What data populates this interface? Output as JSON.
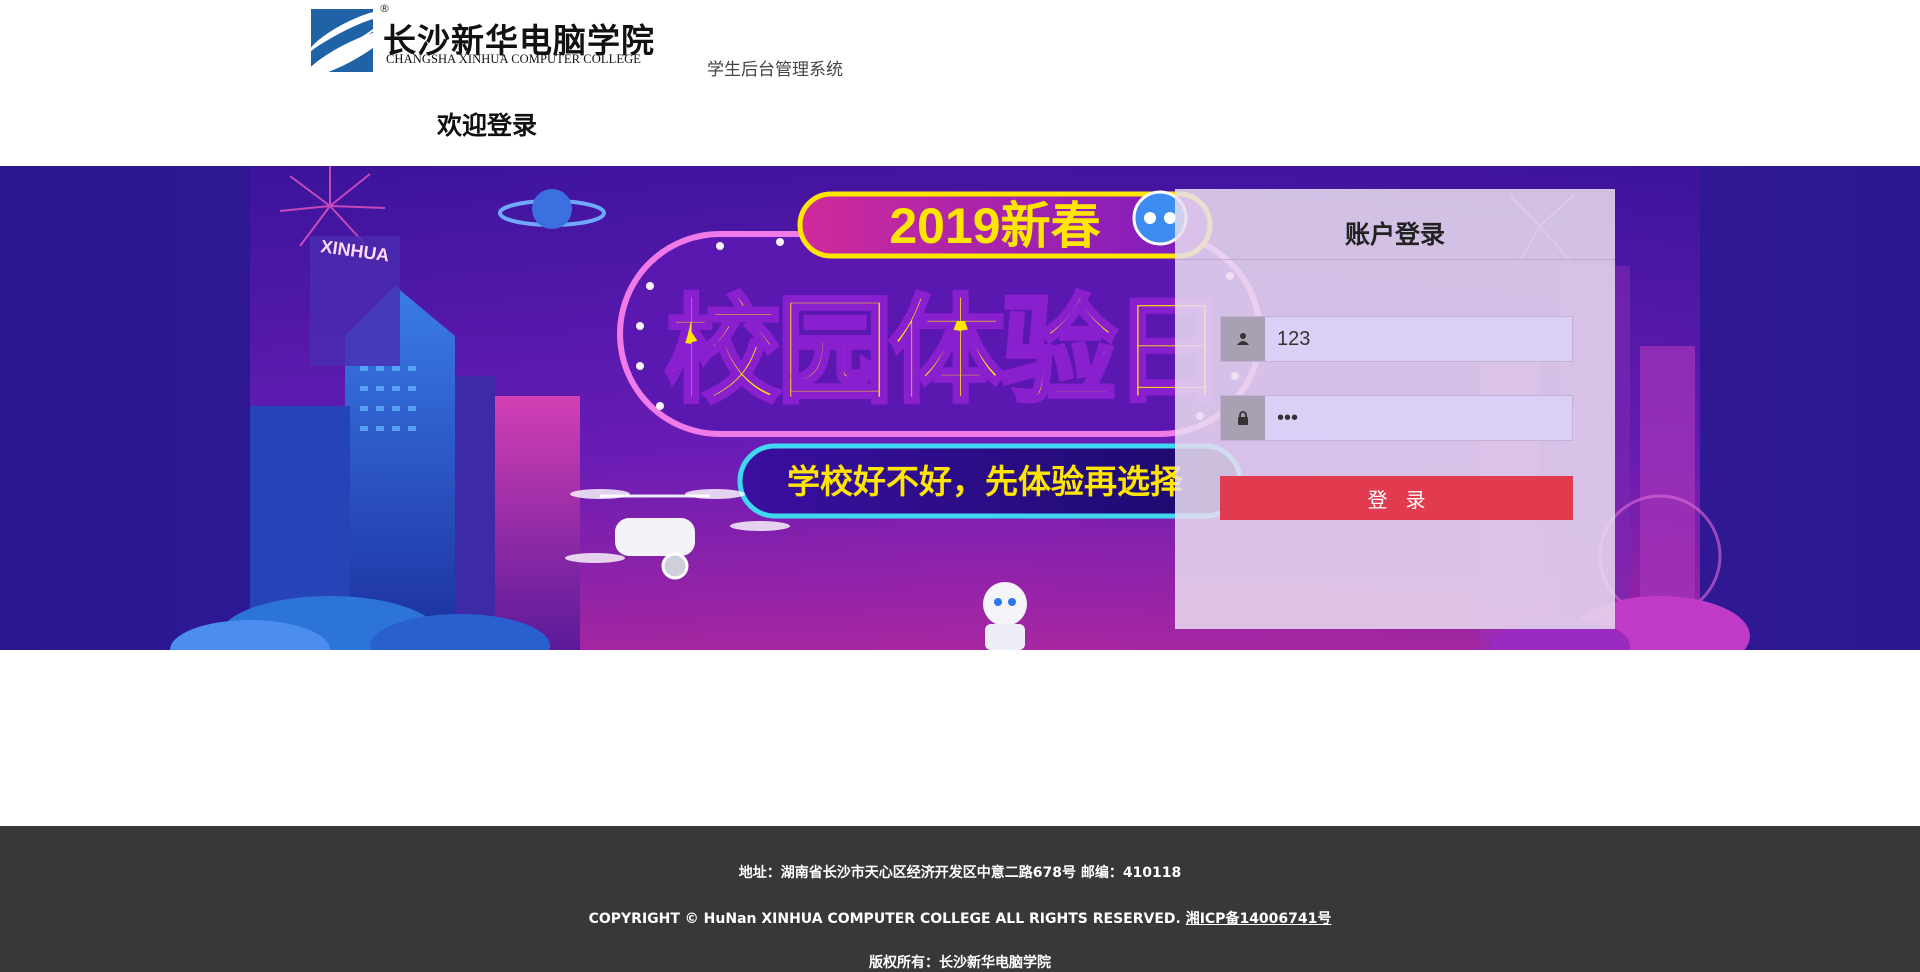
{
  "header": {
    "logo": {
      "registered_mark": "®",
      "name_cn": "长沙新华电脑学院",
      "name_en": "CHANGSHA XINHUA COMPUTER COLLEGE"
    },
    "system_name": "学生后台管理系统",
    "welcome": "欢迎登录"
  },
  "banner": {
    "headline_year": "2019新春",
    "headline_main": "校园体验日",
    "slogan": "学校好不好，先体验再选择",
    "sign_text": "XINHUA"
  },
  "login": {
    "title": "账户登录",
    "username": {
      "value": "123",
      "icon": "user-icon"
    },
    "password": {
      "value": "123",
      "icon": "lock-icon"
    },
    "submit_label": "登录"
  },
  "footer": {
    "address": "地址：湖南省长沙市天心区经济开发区中意二路678号 邮编：410118",
    "copyright": "COPYRIGHT © HuNan XINHUA COMPUTER COLLEGE ALL RIGHTS RESERVED.",
    "icp": "湘ICP备14006741号",
    "rights": "版权所有：长沙新华电脑学院"
  },
  "colors": {
    "footer_bg": "#383838",
    "login_button": "#e23a4e",
    "logo_blue": "#1f62a6",
    "banner_purple": "#571bb0",
    "headline_yellow": "#ffe600"
  }
}
